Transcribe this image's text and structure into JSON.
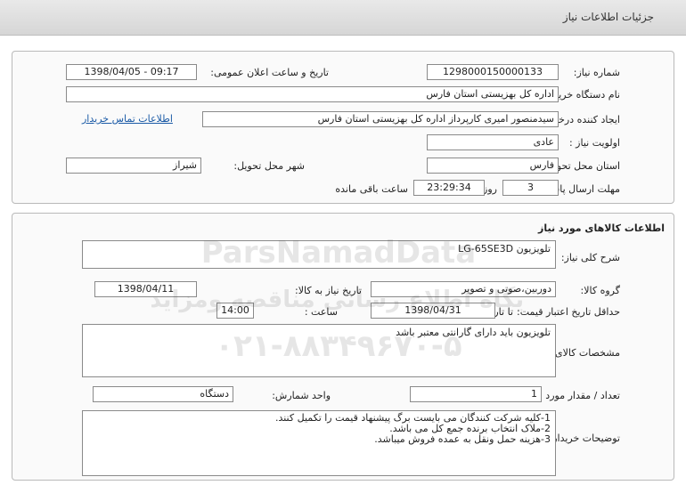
{
  "header": {
    "title": "جزئیات اطلاعات نیاز"
  },
  "need_info": {
    "need_number_label": "شماره نیاز:",
    "need_number": "1298000150000133",
    "announce_label": "تاریخ و ساعت اعلان عمومی:",
    "announce_value": "1398/04/05 - 09:17",
    "buyer_label": "نام دستگاه خریدار:",
    "buyer_value": "اداره کل بهزیستی استان فارس",
    "creator_label": "ایجاد کننده درخواست:",
    "creator_value": "سیدمنصور امیری کارپرداز اداره کل بهزیستی استان فارس",
    "contact_link": "اطلاعات تماس خریدار",
    "priority_label": "اولویت نیاز :",
    "priority_value": "عادی",
    "province_label": "استان محل تحویل:",
    "province_value": "فارس",
    "city_label": "شهر محل تحویل:",
    "city_value": "شیراز",
    "deadline_label": "مهلت ارسال پاسخ:",
    "days_value": "3",
    "days_and": "روز و",
    "time_remaining": "23:29:34",
    "remaining_text": "ساعت باقی مانده"
  },
  "goods": {
    "section_title": "اطلاعات کالاهای مورد نیاز",
    "general_desc_label": "شرح کلی نیاز:",
    "general_desc_value": "تلویزیون LG-65SE3D",
    "group_label": "گروه کالا:",
    "group_value": "دوربین،صوتی و تصویر",
    "need_date_label": "تاریخ نیاز به کالا:",
    "need_date_value": "1398/04/11",
    "validity_label": "حداقل تاریخ اعتبار قیمت:",
    "until_date_label": "تا تاریخ :",
    "until_date_value": "1398/04/31",
    "hour_label": "ساعت :",
    "hour_value": "14:00",
    "spec_label": "مشخصات کالای مورد نیاز:",
    "spec_value": "تلویزیون باید دارای گارانتی معتبر باشد",
    "qty_label": "تعداد / مقدار مورد نیاز:",
    "qty_value": "1",
    "unit_label": "واحد شمارش:",
    "unit_value": "دستگاه",
    "buyer_notes_label": "توضیحات خریدار:",
    "buyer_notes": [
      "1-کلیه شرکت کنندگان می بایست برگ پیشنهاد قیمت را تکمیل کنند.",
      "2-ملاک انتخاب برنده جمع کل می باشد.",
      "3-هزینه حمل ونقل به عمده فروش میباشد."
    ]
  },
  "watermark": {
    "brand": "ParsNamadData",
    "line1": "پایگاه اطلاع رسانی مناقصه ومزایده",
    "line2": "۰۲۱-۸۸۳۴۹۶۷۰-۵"
  },
  "colors": {
    "header_bg": "#dcdcdc",
    "link": "#1a5aa6",
    "panel_border": "#b9b9b9"
  }
}
